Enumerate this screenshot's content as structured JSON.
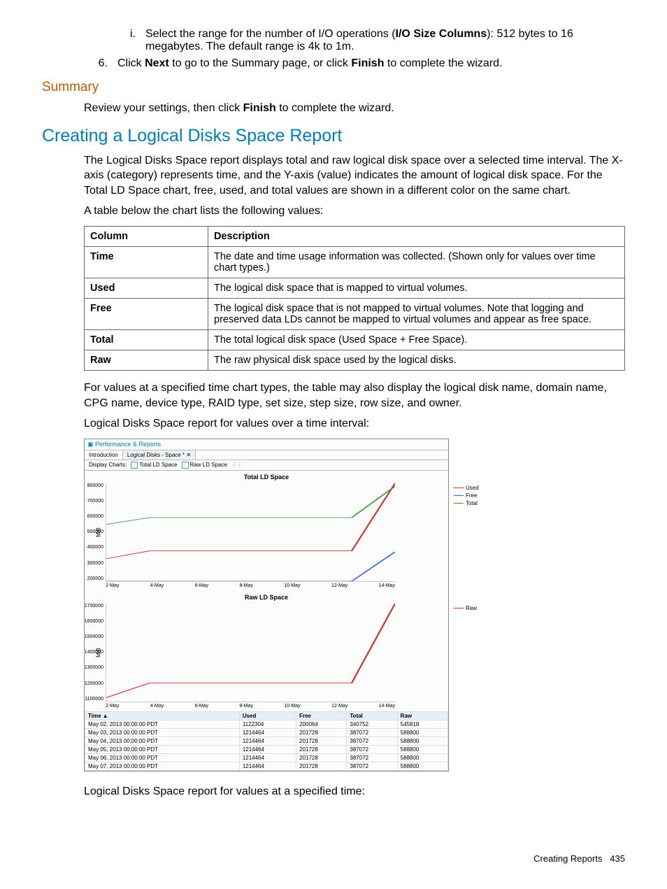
{
  "step_i": {
    "marker": "i.",
    "text_before": "Select the range for the number of I/O operations (",
    "bold": "I/O Size Columns",
    "text_after": "): 512 bytes to 16 megabytes. The default range is 4k to 1m."
  },
  "step_6": {
    "marker": "6.",
    "t1": "Click ",
    "b1": "Next",
    "t2": " to go to the Summary page, or click ",
    "b2": "Finish",
    "t3": " to complete the wizard."
  },
  "summary_heading": "Summary",
  "summary_body": {
    "t1": "Review your settings, then click ",
    "b": "Finish",
    "t2": " to complete the wizard."
  },
  "section_heading": "Creating a Logical Disks Space Report",
  "para1": "The Logical Disks Space report displays total and raw logical disk space over a selected time interval. The X-axis (category) represents time, and the Y-axis (value) indicates the amount of logical disk space. For the Total LD Space chart, free, used, and total values are shown in a different color on the same chart.",
  "para2": "A table below the chart lists the following values:",
  "table": {
    "head": {
      "c1": "Column",
      "c2": "Description"
    },
    "rows": [
      {
        "c1": "Time",
        "c2": "The date and time usage information was collected. (Shown only for values over time chart types.)"
      },
      {
        "c1": "Used",
        "c2": "The logical disk space that is mapped to virtual volumes."
      },
      {
        "c1": "Free",
        "c2": "The logical disk space that is not mapped to virtual volumes. Note that logging and preserved data LDs cannot be mapped to virtual volumes and appear as free space."
      },
      {
        "c1": "Total",
        "c2": "The total logical disk space (Used Space + Free Space)."
      },
      {
        "c1": "Raw",
        "c2": "The raw physical disk space used by the logical disks."
      }
    ]
  },
  "para3": "For values at a specified time chart types, the table may also display the logical disk name, domain name, CPG name, device type, RAID type, set size, step size, row size, and owner.",
  "para4": "Logical Disks Space report for values over a time interval:",
  "para5": "Logical Disks Space report for values at a specified time:",
  "figure": {
    "window_title": "Performance & Reports",
    "tab1": "Introduction",
    "tab2": "Logical Disks - Space *",
    "toolbar": {
      "label": "Display Charts:",
      "cb1": "Total LD Space",
      "cb2": "Raw LD Space"
    },
    "chart1_title": "Total LD Space",
    "chart2_title": "Raw LD Space",
    "ylabel": "MiB",
    "legend1": [
      "Used",
      "Free",
      "Total"
    ],
    "legend2": [
      "Raw"
    ],
    "datatable": {
      "headers": [
        "Time",
        "Used",
        "Free",
        "Total",
        "Raw"
      ],
      "rows": [
        [
          "May 02, 2013 00:00:00 PDT",
          "1122304",
          "200064",
          "340752",
          "545818"
        ],
        [
          "May 03, 2013 00:00:00 PDT",
          "1214464",
          "201728",
          "387072",
          "588800"
        ],
        [
          "May 04, 2013 00:00:00 PDT",
          "1214464",
          "201728",
          "387072",
          "588800"
        ],
        [
          "May 05, 2013 00:00:00 PDT",
          "1214464",
          "201728",
          "387072",
          "588800"
        ],
        [
          "May 06, 2013 00:00:00 PDT",
          "1214464",
          "201728",
          "387072",
          "588800"
        ],
        [
          "May 07, 2013 00:00:00 PDT",
          "1214464",
          "201728",
          "387072",
          "588800"
        ]
      ]
    }
  },
  "chart_data": [
    {
      "type": "line",
      "title": "Total LD Space",
      "xlabel": "",
      "ylabel": "MiB",
      "ylim": [
        200000,
        800000
      ],
      "categories": [
        "2-May",
        "4-May",
        "6-May",
        "8-May",
        "10-May",
        "12-May",
        "14-May"
      ],
      "series": [
        {
          "name": "Used",
          "values": [
            340000,
            387000,
            387000,
            387000,
            387000,
            387000,
            800000
          ]
        },
        {
          "name": "Free",
          "values": [
            200000,
            202000,
            202000,
            202000,
            202000,
            202000,
            380000
          ]
        },
        {
          "name": "Total",
          "values": [
            546000,
            589000,
            589000,
            589000,
            589000,
            589000,
            780000
          ]
        }
      ]
    },
    {
      "type": "line",
      "title": "Raw LD Space",
      "xlabel": "",
      "ylabel": "MiB",
      "ylim": [
        1100000,
        1700000
      ],
      "categories": [
        "2-May",
        "4-May",
        "6-May",
        "8-May",
        "10-May",
        "12-May",
        "14-May"
      ],
      "series": [
        {
          "name": "Raw",
          "values": [
            1122000,
            1214000,
            1214000,
            1214000,
            1214000,
            1214000,
            1700000
          ]
        }
      ]
    }
  ],
  "footer": {
    "label": "Creating Reports",
    "page": "435"
  }
}
